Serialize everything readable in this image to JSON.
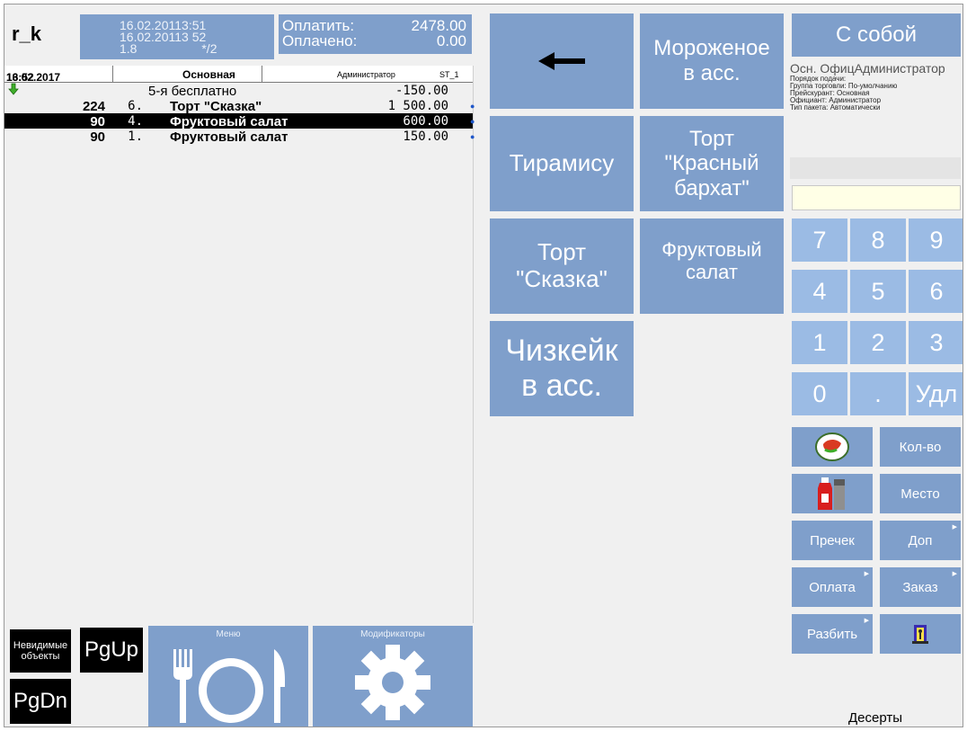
{
  "header": {
    "logo": "r_k",
    "time_line1": "16.02.20113:51",
    "time_line2": "16.02.20113 52",
    "time_line3": "1.8",
    "time_line4": "*/2",
    "pay_label": "Оплатить:",
    "pay_value": "2478.00",
    "paid_label": "Оплачено:",
    "paid_value": "0.00"
  },
  "order": {
    "date": "16.02.2017",
    "time": "13:52",
    "category": "Основная",
    "user": "Администратор",
    "station": "ST_1",
    "rows": [
      {
        "qty": "",
        "idx": "",
        "name": "5-я бесплатно",
        "price": "-150.00",
        "discount": true
      },
      {
        "qty": "224",
        "idx": "6.",
        "name": "Торт \"Сказка\"",
        "price": "1 500.00"
      },
      {
        "qty": "90",
        "idx": "4.",
        "name": "Фруктовый салат",
        "price": "600.00",
        "selected": true
      },
      {
        "qty": "90",
        "idx": "1.",
        "name": "Фруктовый салат",
        "price": "150.00"
      }
    ]
  },
  "bottom_left": {
    "invisible_line1": "Невидимые",
    "invisible_line2": "объекты",
    "pgup": "PgUp",
    "pgdn": "PgDn",
    "menu": "Меню",
    "modifiers": "Модификаторы"
  },
  "tiles": {
    "ice_line1": "Мороженое",
    "ice_line2": "в асс.",
    "tiramisu": "Тирамису",
    "red_line1": "Торт",
    "red_line2": "\"Красный",
    "red_line3": "бархат\"",
    "skazka_line1": "Торт",
    "skazka_line2": "\"Сказка\"",
    "fruit_line1": "Фруктовый",
    "fruit_line2": "салат",
    "cheese_line1": "Чизкейк",
    "cheese_line2": "в асс."
  },
  "right": {
    "s_soboy": "С собой",
    "info_title": "Осн. ОфицАдминистратор",
    "info_lines": [
      "Порядок подачи:",
      "Группа торговли: По-умолчанию",
      "Прейскурант: Основная",
      "Официант: Администратор",
      "Тип пакета: Автоматически"
    ],
    "keys": [
      "7",
      "8",
      "9",
      "4",
      "5",
      "6",
      "1",
      "2",
      "3",
      "0",
      ".",
      "Удл"
    ],
    "actions": {
      "qty": "Кол-во",
      "place": "Место",
      "precheck": "Пречек",
      "dop": "Доп",
      "pay": "Оплата",
      "order": "Заказ",
      "split": "Разбить"
    },
    "category_label": "Десерты"
  },
  "colors": {
    "tile": "#7f9fcb",
    "key": "#9bbbe4",
    "selected_row": "#000000",
    "entry": "#ffffe6"
  },
  "icons": {
    "back": "arrow-left-icon",
    "discount": "green-down-arrow-icon",
    "menu": "plate-fork-knife-icon",
    "modifiers": "gear-icon",
    "food": "food-plate-icon",
    "sauce": "ketchup-bottle-icon",
    "exit": "exit-door-icon"
  }
}
